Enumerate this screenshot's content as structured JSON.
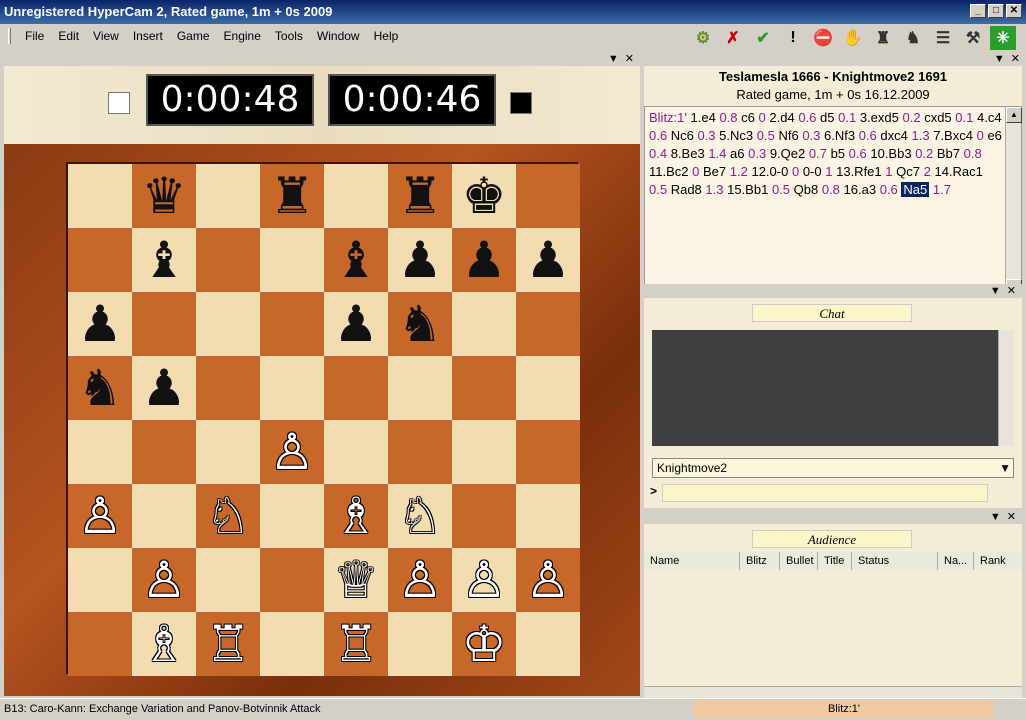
{
  "window": {
    "title": "Unregistered HyperCam 2",
    "title_tail": ", Rated game, 1m + 0s 2009",
    "min": "_",
    "max": "□",
    "close": "✕"
  },
  "menu": [
    "File",
    "Edit",
    "View",
    "Insert",
    "Game",
    "Engine",
    "Tools",
    "Window",
    "Help"
  ],
  "toolbar": {
    "icons": [
      "engine-icon",
      "cross-icon",
      "check-icon",
      "exclaim-icon",
      "stop-icon",
      "hand-icon",
      "robot-icon",
      "group-icon",
      "sliders-icon",
      "settings-icon",
      "star-icon"
    ],
    "glyphs": [
      "⚙",
      "✗",
      "✔",
      "!",
      "⛔",
      "✋",
      "♜",
      "♞",
      "☰",
      "⚒",
      "✳"
    ]
  },
  "pane_controls": {
    "arrow": "▼",
    "close": "✕"
  },
  "clocks": {
    "white": "0:00:48",
    "black": "0:00:46"
  },
  "board": {
    "rows": [
      [
        "",
        "♛",
        "",
        "♜",
        "",
        "♜",
        "♚",
        ""
      ],
      [
        "",
        "♝",
        "",
        "",
        "♝",
        "♟",
        "♟",
        "♟"
      ],
      [
        "♟",
        "",
        "",
        "",
        "♟",
        "♞",
        "",
        ""
      ],
      [
        "♞",
        "♟",
        "",
        "",
        "",
        "",
        "",
        ""
      ],
      [
        "",
        "",
        "",
        "♙",
        "",
        "",
        "",
        ""
      ],
      [
        "♙",
        "",
        "♘",
        "",
        "♗",
        "♘",
        "",
        ""
      ],
      [
        "",
        "♙",
        "",
        "",
        "♕",
        "♙",
        "♙",
        "♙"
      ],
      [
        "",
        "♗",
        "♖",
        "",
        "♖",
        "",
        "♔",
        ""
      ]
    ]
  },
  "game": {
    "players": "Teslamesla 1666 - Knightmove2 1691",
    "info": "Rated game, 1m + 0s 16.12.2009",
    "moves": [
      {
        "t": "Blitz:1'",
        "c": "ev"
      },
      {
        "t": "1.e4",
        "c": "mv"
      },
      {
        "t": "0.8",
        "c": "ev"
      },
      {
        "t": "c6",
        "c": "mv"
      },
      {
        "t": "0",
        "c": "ev"
      },
      {
        "t": "2.d4",
        "c": "mv"
      },
      {
        "t": "0.6",
        "c": "ev"
      },
      {
        "t": "d5",
        "c": "mv"
      },
      {
        "t": "0.1",
        "c": "ev"
      },
      {
        "t": "3.exd5",
        "c": "mv"
      },
      {
        "t": "0.2",
        "c": "ev"
      },
      {
        "t": "cxd5",
        "c": "mv"
      },
      {
        "t": "0.1",
        "c": "ev"
      },
      {
        "t": "4.c4",
        "c": "mv"
      },
      {
        "t": "0.6",
        "c": "ev"
      },
      {
        "t": "Nc6",
        "c": "mv"
      },
      {
        "t": "0.3",
        "c": "ev"
      },
      {
        "t": "5.Nc3",
        "c": "mv"
      },
      {
        "t": "0.5",
        "c": "ev"
      },
      {
        "t": "Nf6",
        "c": "mv"
      },
      {
        "t": "0.3",
        "c": "ev"
      },
      {
        "t": "6.Nf3",
        "c": "mv"
      },
      {
        "t": "0.6",
        "c": "ev"
      },
      {
        "t": "dxc4",
        "c": "mv"
      },
      {
        "t": "1.3",
        "c": "ev"
      },
      {
        "t": "7.Bxc4",
        "c": "mv"
      },
      {
        "t": "0",
        "c": "ev"
      },
      {
        "t": "e6",
        "c": "mv"
      },
      {
        "t": "0.4",
        "c": "ev"
      },
      {
        "t": "8.Be3",
        "c": "mv"
      },
      {
        "t": "1.4",
        "c": "ev"
      },
      {
        "t": "a6",
        "c": "mv"
      },
      {
        "t": "0.3",
        "c": "ev"
      },
      {
        "t": "9.Qe2",
        "c": "mv"
      },
      {
        "t": "0.7",
        "c": "ev"
      },
      {
        "t": "b5",
        "c": "mv"
      },
      {
        "t": "0.6",
        "c": "ev"
      },
      {
        "t": "10.Bb3",
        "c": "mv"
      },
      {
        "t": "0.2",
        "c": "ev"
      },
      {
        "t": "Bb7",
        "c": "mv"
      },
      {
        "t": "0.8",
        "c": "ev"
      },
      {
        "t": "11.Bc2",
        "c": "mv"
      },
      {
        "t": "0",
        "c": "ev"
      },
      {
        "t": "Be7",
        "c": "mv"
      },
      {
        "t": "1.2",
        "c": "ev"
      },
      {
        "t": "12.0-0",
        "c": "mv"
      },
      {
        "t": "0",
        "c": "ev"
      },
      {
        "t": "0-0",
        "c": "mv"
      },
      {
        "t": "1",
        "c": "ev"
      },
      {
        "t": "13.Rfe1",
        "c": "mv"
      },
      {
        "t": "1",
        "c": "ev"
      },
      {
        "t": "Qc7",
        "c": "mv"
      },
      {
        "t": "2",
        "c": "ev"
      },
      {
        "t": "14.Rac1",
        "c": "mv"
      },
      {
        "t": "0.5",
        "c": "ev"
      },
      {
        "t": "Rad8",
        "c": "mv"
      },
      {
        "t": "1.3",
        "c": "ev"
      },
      {
        "t": "15.Bb1",
        "c": "mv"
      },
      {
        "t": "0.5",
        "c": "ev"
      },
      {
        "t": "Qb8",
        "c": "mv"
      },
      {
        "t": "0.8",
        "c": "ev"
      },
      {
        "t": "16.a3",
        "c": "mv"
      },
      {
        "t": "0.6",
        "c": "ev"
      },
      {
        "t": "Na5",
        "c": "cur"
      },
      {
        "t": "1.7",
        "c": "ev"
      }
    ]
  },
  "chat": {
    "header": "Chat",
    "recipient": "Knightmove2",
    "prompt": ">"
  },
  "audience": {
    "header": "Audience",
    "columns": [
      "Name",
      "Blitz",
      "Bullet",
      "Title",
      "Status",
      "Na...",
      "Rank"
    ]
  },
  "status": {
    "opening": "B13: Caro-Kann: Exchange Variation and Panov-Botvinnik Attack",
    "mode": "Blitz:1'"
  }
}
